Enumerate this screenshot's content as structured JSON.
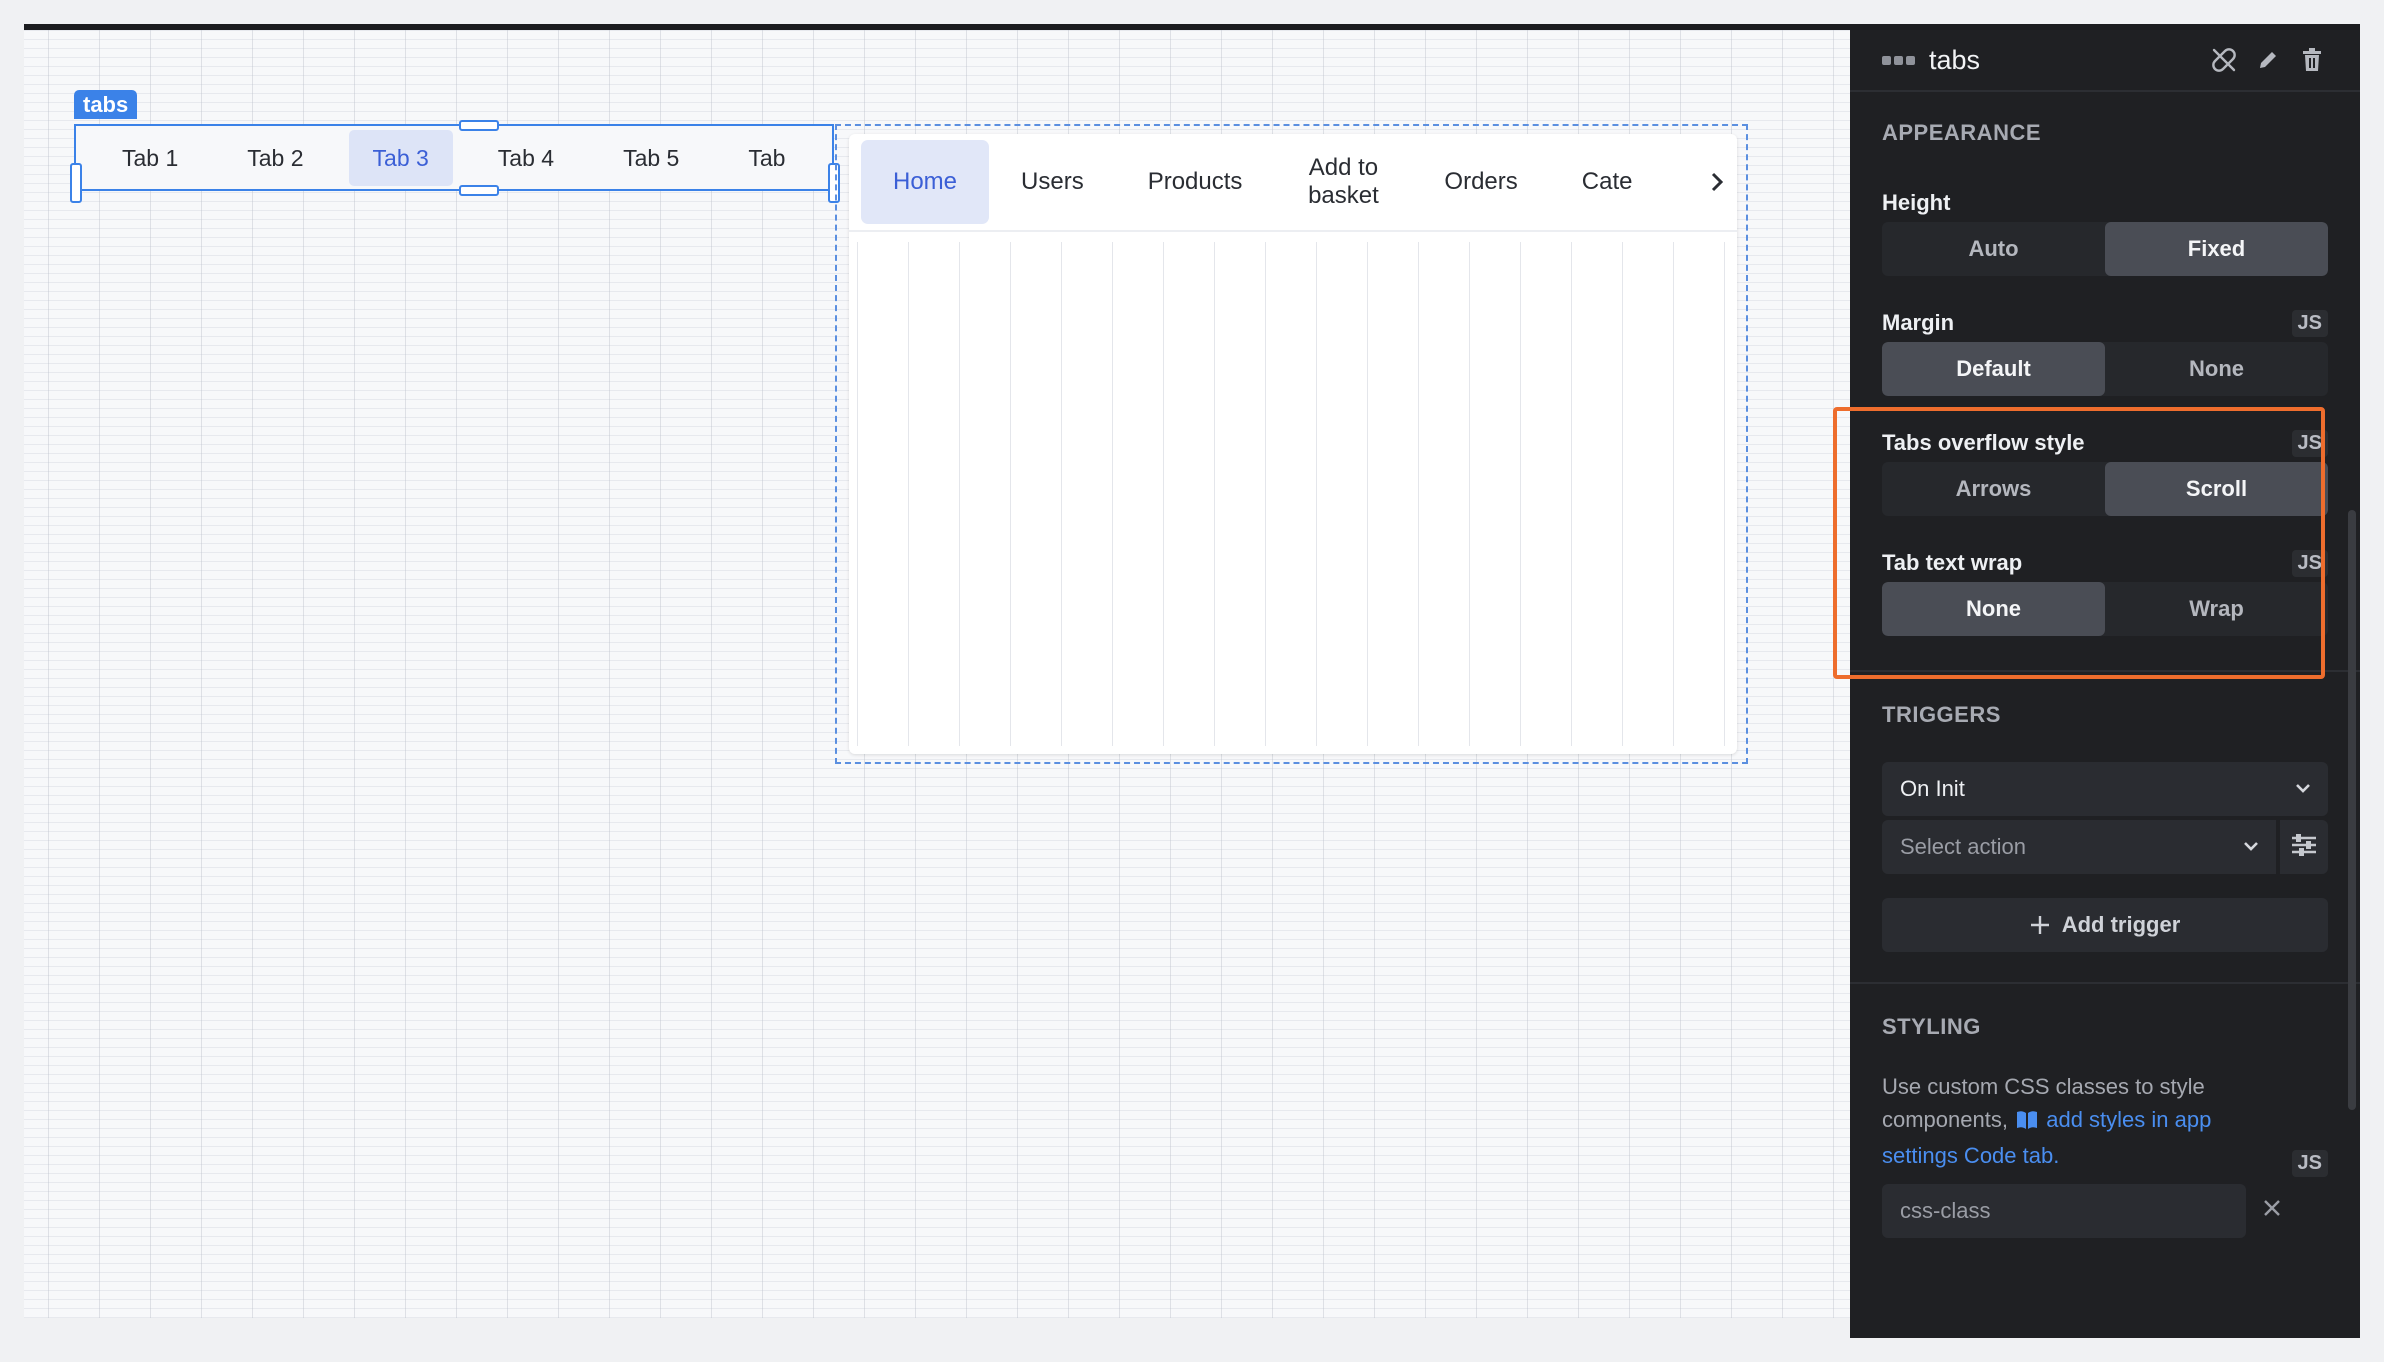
{
  "canvas": {
    "component_tag": "tabs",
    "tabs": [
      "Tab 1",
      "Tab 2",
      "Tab 3",
      "Tab 4",
      "Tab 5",
      "Tab"
    ],
    "active_tab_index": 2,
    "preview_tabs": [
      "Home",
      "Users",
      "Products",
      "Add to basket",
      "Orders",
      "Cate"
    ],
    "preview_active_index": 0,
    "preview_arrow": "›"
  },
  "panel": {
    "title": "tabs",
    "header_icons": [
      "unlink-icon",
      "pencil-icon",
      "trash-icon"
    ],
    "appearance": {
      "section_title": "APPEARANCE",
      "height": {
        "label": "Height",
        "options": [
          "Auto",
          "Fixed"
        ],
        "selected": "Fixed"
      },
      "margin": {
        "label": "Margin",
        "js": "JS",
        "options": [
          "Default",
          "None"
        ],
        "selected": "Default"
      },
      "overflow": {
        "label": "Tabs overflow style",
        "js": "JS",
        "options": [
          "Arrows",
          "Scroll"
        ],
        "selected": "Scroll"
      },
      "wrap": {
        "label": "Tab text wrap",
        "js": "JS",
        "options": [
          "None",
          "Wrap"
        ],
        "selected": "None"
      }
    },
    "triggers": {
      "section_title": "TRIGGERS",
      "event": "On Init",
      "action_placeholder": "Select action",
      "add_label": "Add trigger"
    },
    "styling": {
      "section_title": "STYLING",
      "help_prefix": "Use custom CSS classes to style components,",
      "help_link": "add styles in app settings Code tab.",
      "js": "JS",
      "css_placeholder": "css-class"
    }
  },
  "colors": {
    "accent": "#3b82e8",
    "highlight": "#ee6d2d",
    "panel_bg": "#1f2023"
  }
}
